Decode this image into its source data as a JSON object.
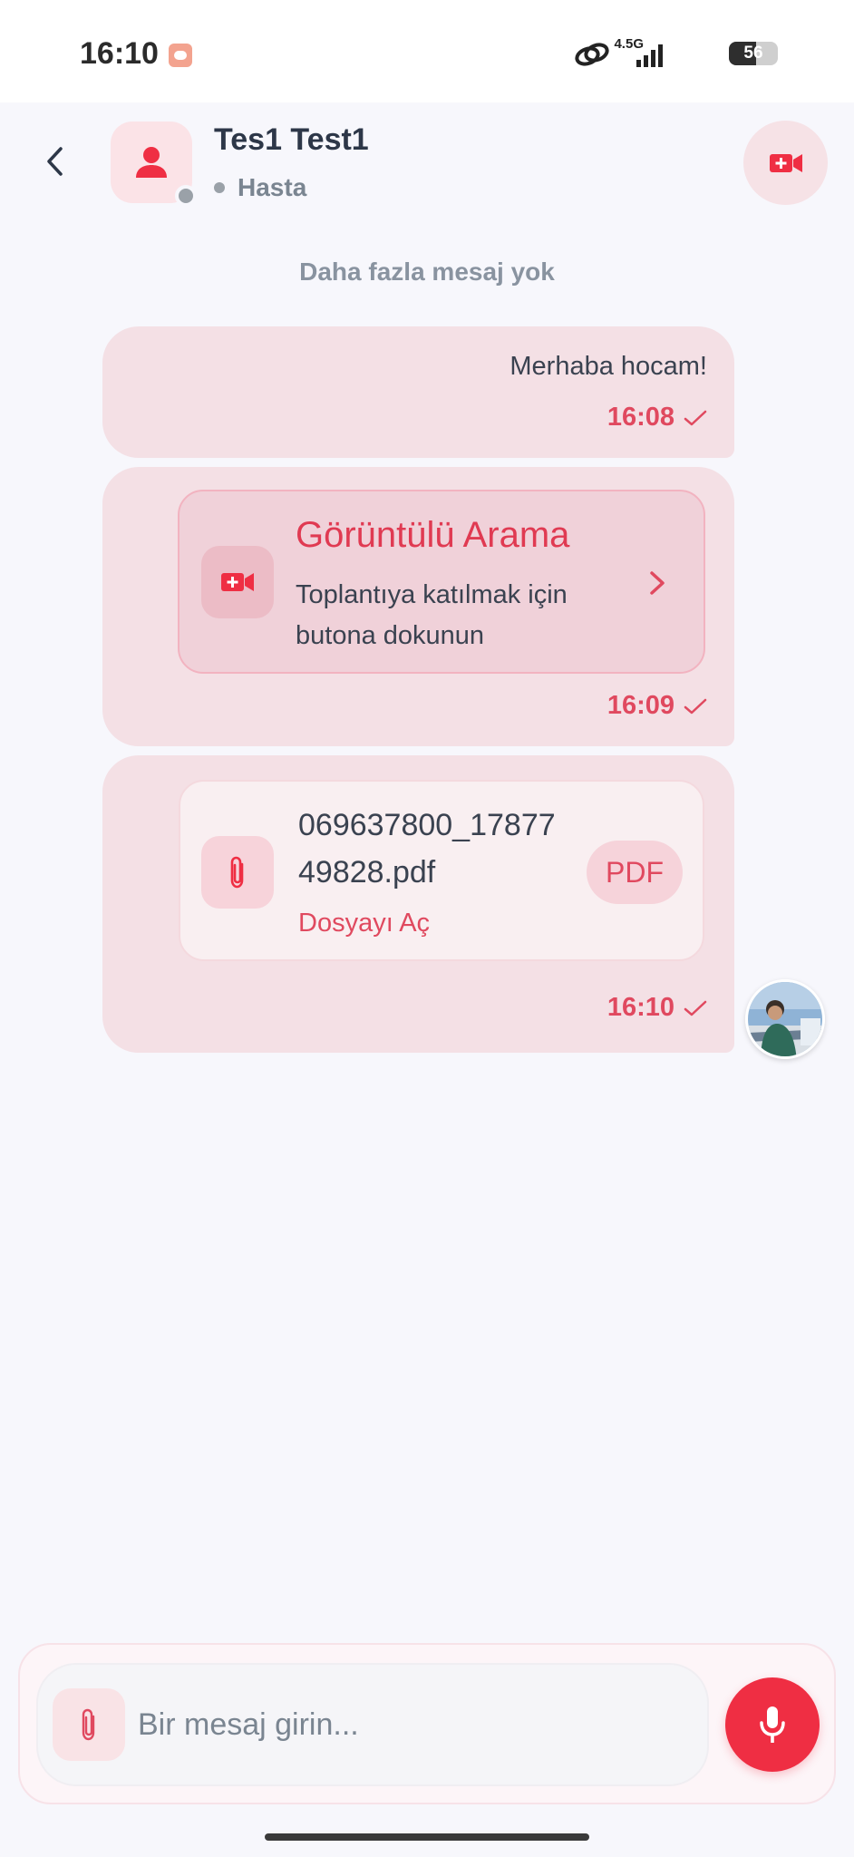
{
  "status_bar": {
    "time": "16:10",
    "network_label": "4.5G",
    "battery_percent": 56,
    "battery_text": "56"
  },
  "header": {
    "contact_name": "Tes1 Test1",
    "contact_role": "Hasta",
    "presence": "offline"
  },
  "conversation": {
    "no_more_messages": "Daha fazla mesaj yok",
    "messages": [
      {
        "text": "Merhaba hocam!",
        "time": "16:08",
        "status": "sent"
      },
      {
        "call_card": {
          "title": "Görüntülü Arama",
          "description": "Toplantıya katılmak için butona dokunun"
        },
        "time": "16:09",
        "status": "sent"
      },
      {
        "file_card": {
          "file_name": "069637800_1787749828.pdf",
          "open_label": "Dosyayı Aç",
          "badge": "PDF"
        },
        "time": "16:10",
        "status": "sent"
      }
    ]
  },
  "composer": {
    "placeholder": "Bir mesaj girin..."
  },
  "colors": {
    "accent": "#ef2e43",
    "bubble": "#f4e0e5",
    "background": "#f7f7fc"
  },
  "icons": {
    "back": "chevron-left-icon",
    "avatar": "person-icon",
    "video_call": "video-camera-icon",
    "attach": "paperclip-icon",
    "mic": "microphone-icon",
    "read": "check-icon"
  }
}
